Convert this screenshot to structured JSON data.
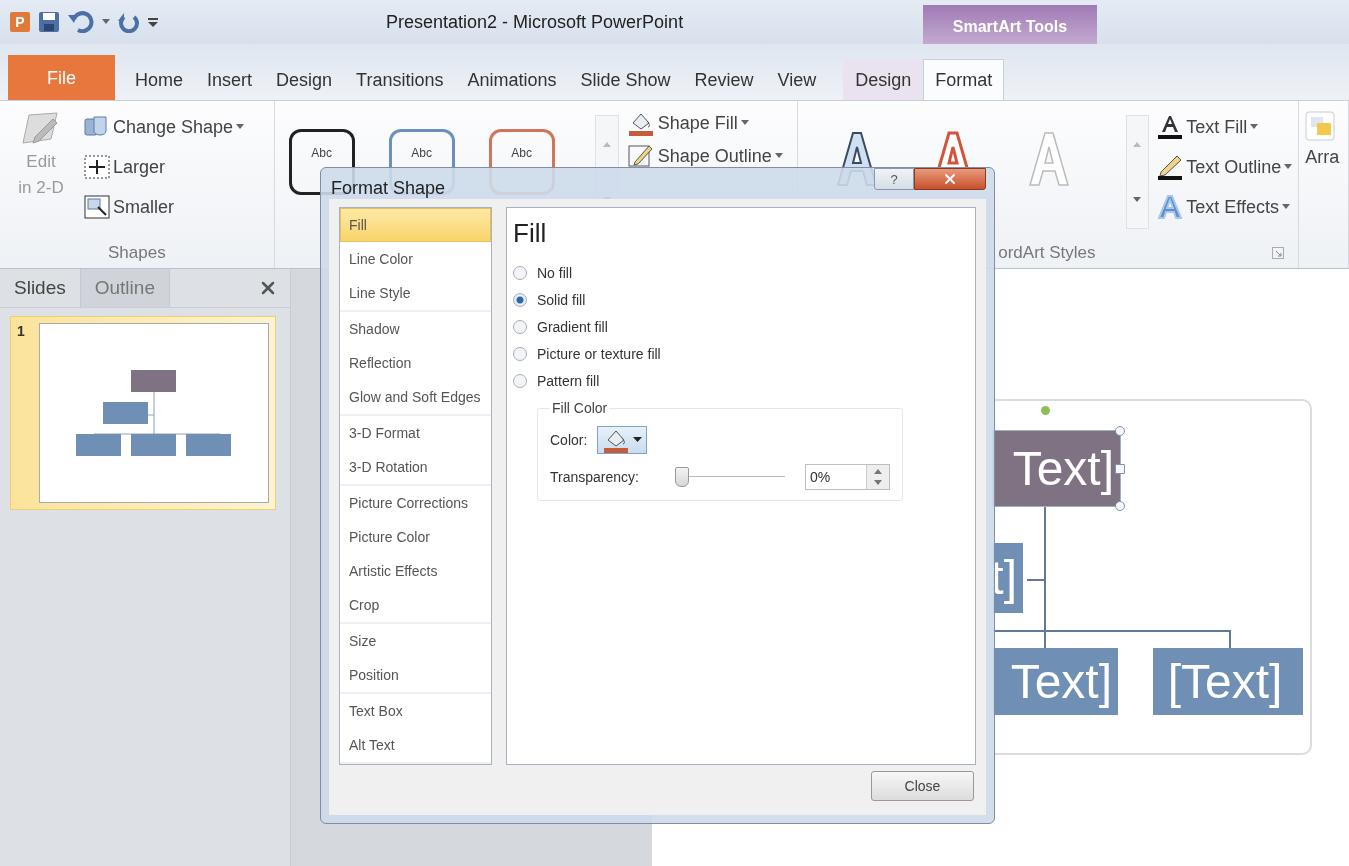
{
  "title_bar": {
    "app_icon": "P",
    "title": "Presentation2 - Microsoft PowerPoint",
    "context_header": "SmartArt Tools"
  },
  "tabs": [
    {
      "label": "File",
      "kind": "file",
      "selected": false
    },
    {
      "label": "Home",
      "kind": "tab",
      "selected": false
    },
    {
      "label": "Insert",
      "kind": "tab",
      "selected": false
    },
    {
      "label": "Design",
      "kind": "tab",
      "selected": false
    },
    {
      "label": "Transitions",
      "kind": "tab",
      "selected": false
    },
    {
      "label": "Animations",
      "kind": "tab",
      "selected": false
    },
    {
      "label": "Slide Show",
      "kind": "tab",
      "selected": false
    },
    {
      "label": "Review",
      "kind": "tab",
      "selected": false
    },
    {
      "label": "View",
      "kind": "tab",
      "selected": false
    },
    {
      "label": "Design",
      "kind": "context",
      "selected": false
    },
    {
      "label": "Format",
      "kind": "context",
      "selected": true
    }
  ],
  "ribbon": {
    "shapes": {
      "edit_button": {
        "label_lines": [
          "Edit",
          "in 2-D"
        ],
        "disabled": true
      },
      "change_shape": "Change Shape",
      "larger": "Larger",
      "smaller": "Smaller",
      "label": "Shapes"
    },
    "shape_styles": {
      "thumbnails": [
        {
          "text": "Abc",
          "color": "#222222"
        },
        {
          "text": "Abc",
          "color": "#6d8fbd"
        },
        {
          "text": "Abc",
          "color": "#d0745a"
        }
      ],
      "shape_fill": "Shape Fill",
      "shape_outline": "Shape Outline"
    },
    "wordart_styles": {
      "text_fill": "Text Fill",
      "text_outline": "Text Outline",
      "text_effects": "Text Effects",
      "label": "ordArt Styles"
    },
    "arrange": {
      "label": "Arra"
    }
  },
  "slides_panel": {
    "tabs": [
      {
        "label": "Slides",
        "selected": true
      },
      {
        "label": "Outline",
        "selected": false
      }
    ],
    "slides": [
      {
        "number": "1",
        "selected": true
      }
    ]
  },
  "canvas": {
    "nodes": [
      {
        "text": "Text]",
        "kind": "top",
        "selected": true
      },
      {
        "text": "t]",
        "kind": "assistant",
        "selected": false
      },
      {
        "text": "Text]",
        "kind": "left",
        "selected": false
      },
      {
        "text": "[Text]",
        "kind": "right",
        "selected": false
      }
    ]
  },
  "dialog": {
    "title": "Format Shape",
    "help": "?",
    "category_groups": [
      {
        "items": [
          {
            "label": "Fill",
            "selected": true
          },
          {
            "label": "Line Color",
            "selected": false
          },
          {
            "label": "Line Style",
            "selected": false
          }
        ]
      },
      {
        "items": [
          {
            "label": "Shadow",
            "selected": false
          },
          {
            "label": "Reflection",
            "selected": false
          },
          {
            "label": "Glow and Soft Edges",
            "selected": false
          }
        ]
      },
      {
        "items": [
          {
            "label": "3-D Format",
            "selected": false
          },
          {
            "label": "3-D Rotation",
            "selected": false
          }
        ]
      },
      {
        "items": [
          {
            "label": "Picture Corrections",
            "selected": false
          },
          {
            "label": "Picture Color",
            "selected": false
          },
          {
            "label": "Artistic Effects",
            "selected": false
          },
          {
            "label": "Crop",
            "selected": false
          }
        ]
      },
      {
        "items": [
          {
            "label": "Size",
            "selected": false
          },
          {
            "label": "Position",
            "selected": false
          }
        ]
      },
      {
        "items": [
          {
            "label": "Text Box",
            "selected": false
          },
          {
            "label": "Alt Text",
            "selected": false
          }
        ]
      }
    ],
    "heading": "Fill",
    "options": [
      {
        "label": "No fill",
        "selected": false
      },
      {
        "label": "Solid fill",
        "selected": true
      },
      {
        "label": "Gradient fill",
        "selected": false
      },
      {
        "label": "Picture or texture fill",
        "selected": false
      },
      {
        "label": "Pattern fill",
        "selected": false
      }
    ],
    "fill_color": {
      "legend": "Fill Color",
      "color_label": "Color:",
      "transparency_label": "Transparency:",
      "transparency": {
        "level": 0,
        "value": "0%"
      }
    },
    "close_button": "Close"
  }
}
